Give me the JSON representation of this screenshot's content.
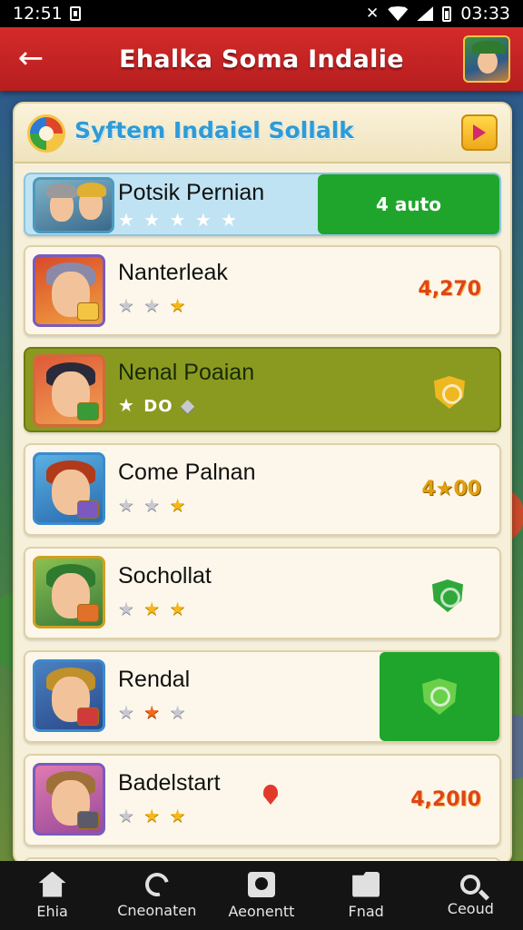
{
  "status_bar": {
    "time": "12:51",
    "clock": "03:33"
  },
  "header": {
    "title": "Ehalka Soma Indalie"
  },
  "panel": {
    "title": "Syftem Indaiel Sollalk"
  },
  "rows": [
    {
      "name": "Potsik Pernian",
      "stars": "★ ★ ★ ★ ★",
      "score": "4 auto",
      "style": "blue"
    },
    {
      "name": "Nanterleak",
      "stars": "★ ★ ★",
      "score": "4,270",
      "style": "plain"
    },
    {
      "name": "Nenal Poaian",
      "stars": "DO",
      "score": "",
      "style": "olive"
    },
    {
      "name": "Come Palnan",
      "stars": "★ ★ ★",
      "score": "4★00",
      "style": "plain"
    },
    {
      "name": "Sochollat",
      "stars": "★ ★ ★",
      "score": "",
      "style": "plain"
    },
    {
      "name": "Rendal",
      "stars": "★ ★ ★",
      "score": "",
      "style": "green"
    },
    {
      "name": "Badelstart",
      "stars": "★ ★ ★",
      "score": "4,20I0",
      "style": "plain"
    }
  ],
  "nav": [
    {
      "label": "Ehia",
      "icon": "home-icon"
    },
    {
      "label": "Cneonaten",
      "icon": "swirl-icon"
    },
    {
      "label": "Aeonentt",
      "icon": "camera-icon"
    },
    {
      "label": "Fnad",
      "icon": "folder-icon"
    },
    {
      "label": "Ceoud",
      "icon": "search-icon"
    }
  ],
  "colors": {
    "header_red": "#c62222",
    "accent_green": "#1fa52c",
    "panel_bg": "#f6efd9",
    "score_orange": "#e04418"
  }
}
